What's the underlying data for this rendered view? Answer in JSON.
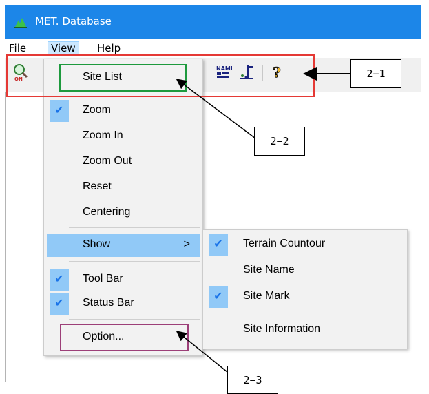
{
  "window": {
    "title": "MET. Database"
  },
  "menubar": {
    "items": [
      "File",
      "View",
      "Help"
    ]
  },
  "view_menu": {
    "items": [
      {
        "label": "Site List",
        "checked": false
      },
      {
        "label": "Zoom",
        "checked": true
      },
      {
        "label": "Zoom In",
        "checked": false
      },
      {
        "label": "Zoom Out",
        "checked": false
      },
      {
        "label": "Reset",
        "checked": false
      },
      {
        "label": "Centering",
        "checked": false
      },
      {
        "label": "Show",
        "checked": false,
        "submenu_arrow": ">"
      },
      {
        "label": "Tool Bar",
        "checked": true
      },
      {
        "label": "Status Bar",
        "checked": true
      },
      {
        "label": "Option...",
        "checked": false
      }
    ]
  },
  "show_submenu": {
    "items": [
      {
        "label": "Terrain Countour",
        "checked": true
      },
      {
        "label": "Site Name",
        "checked": false
      },
      {
        "label": "Site Mark",
        "checked": true
      },
      {
        "label": "Site Information",
        "checked": false
      }
    ]
  },
  "callouts": {
    "c1": "2−1",
    "c2": "2−2",
    "c3": "2−3"
  },
  "colors": {
    "titlebar": "#1c86e8",
    "highlight": "#91c9f7",
    "annotation_red": "#e53935",
    "annotation_green": "#1e9a3e",
    "annotation_purple": "#9c3f78"
  },
  "icons": [
    "zoom-on-icon",
    "name-toggle-icon",
    "site-mark-icon",
    "help-icon",
    "check-icon",
    "chevron-right-icon"
  ]
}
